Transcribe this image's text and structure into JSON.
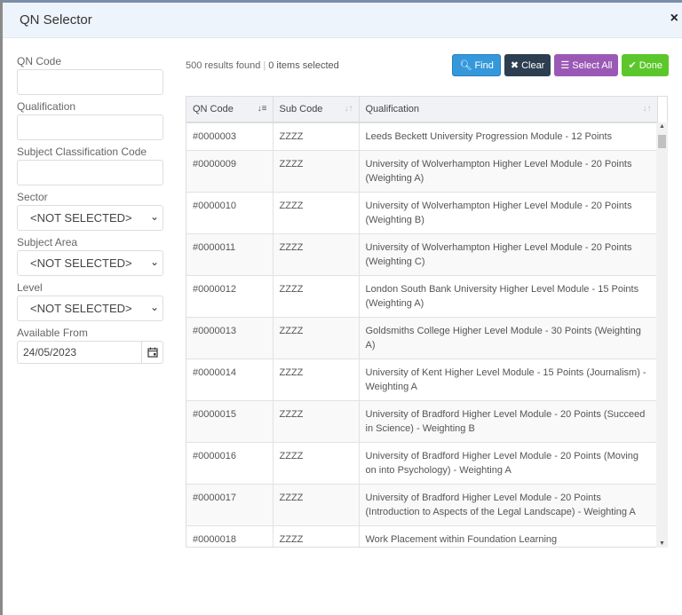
{
  "modal": {
    "title": "QN Selector",
    "close_icon": "×"
  },
  "filters": {
    "qn_code": {
      "label": "QN Code",
      "value": ""
    },
    "qualification": {
      "label": "Qualification",
      "value": ""
    },
    "subject_classification_code": {
      "label": "Subject Classification Code",
      "value": ""
    },
    "sector": {
      "label": "Sector",
      "value": "<NOT SELECTED>"
    },
    "subject_area": {
      "label": "Subject Area",
      "value": "<NOT SELECTED>"
    },
    "level": {
      "label": "Level",
      "value": "<NOT SELECTED>"
    },
    "available_from": {
      "label": "Available From",
      "value": "24/05/2023"
    }
  },
  "summary": {
    "results": "500 results found",
    "selected": "0 items selected"
  },
  "buttons": {
    "find": "Find",
    "clear": "Clear",
    "select_all": "Select All",
    "done": "Done"
  },
  "colors": {
    "find": "#3498db",
    "clear": "#2c3e50",
    "select_all": "#9b59b6",
    "done": "#5cc72b"
  },
  "table": {
    "columns": [
      "QN Code",
      "Sub Code",
      "Qualification"
    ],
    "rows": [
      {
        "qn": "#0000003",
        "sub": "ZZZZ",
        "qual": "Leeds Beckett University Progression Module - 12 Points"
      },
      {
        "qn": "#0000009",
        "sub": "ZZZZ",
        "qual": "University of Wolverhampton Higher Level Module - 20 Points (Weighting A)"
      },
      {
        "qn": "#0000010",
        "sub": "ZZZZ",
        "qual": "University of Wolverhampton Higher Level Module - 20 Points (Weighting B)"
      },
      {
        "qn": "#0000011",
        "sub": "ZZZZ",
        "qual": "University of Wolverhampton Higher Level Module - 20 Points (Weighting C)"
      },
      {
        "qn": "#0000012",
        "sub": "ZZZZ",
        "qual": "London South Bank University Higher Level Module - 15 Points (Weighting A)"
      },
      {
        "qn": "#0000013",
        "sub": "ZZZZ",
        "qual": "Goldsmiths College Higher Level Module - 30 Points (Weighting A)"
      },
      {
        "qn": "#0000014",
        "sub": "ZZZZ",
        "qual": "University of Kent Higher Level Module - 15 Points (Journalism) - Weighting A"
      },
      {
        "qn": "#0000015",
        "sub": "ZZZZ",
        "qual": "University of Bradford Higher Level Module - 20 Points (Succeed in Science) - Weighting B"
      },
      {
        "qn": "#0000016",
        "sub": "ZZZZ",
        "qual": "University of Bradford Higher Level Module - 20 Points (Moving on into Psychology) - Weighting A"
      },
      {
        "qn": "#0000017",
        "sub": "ZZZZ",
        "qual": "University of Bradford Higher Level Module - 20 Points (Introduction to Aspects of the Legal Landscape) - Weighting A"
      },
      {
        "qn": "#0000018",
        "sub": "ZZZZ",
        "qual": "Work Placement within Foundation Learning"
      }
    ]
  }
}
